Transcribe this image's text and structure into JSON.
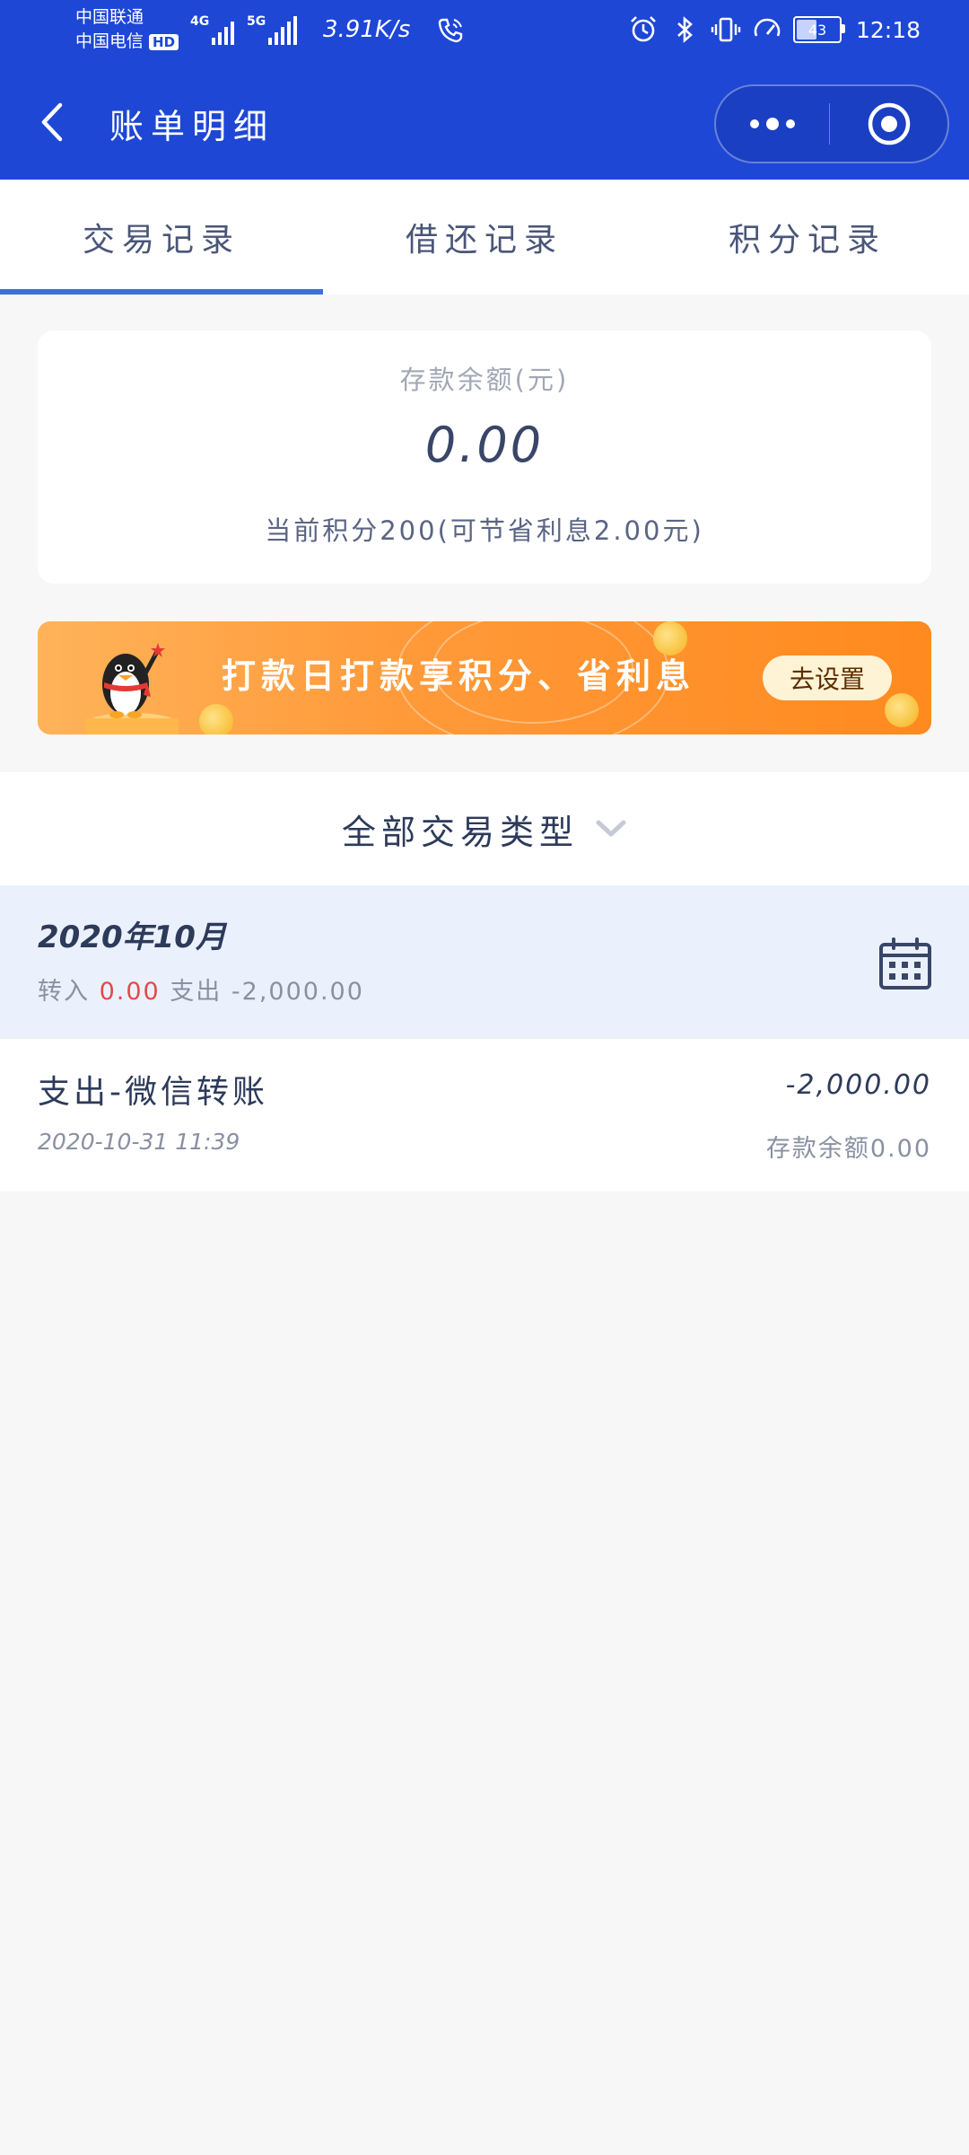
{
  "status_bar": {
    "carrier_1": "中国联通",
    "carrier_2": "中国电信",
    "hd_badge": "HD",
    "signal_1_label": "4G",
    "signal_2_label": "5G",
    "net_speed": "3.91K/s",
    "battery_level": "43",
    "time": "12:18"
  },
  "nav": {
    "title": "账单明细"
  },
  "tabs": [
    {
      "label": "交易记录",
      "active": true
    },
    {
      "label": "借还记录",
      "active": false
    },
    {
      "label": "积分记录",
      "active": false
    }
  ],
  "balance_card": {
    "label": "存款余额(元)",
    "amount": "0.00",
    "points_text": "当前积分200(可节省利息2.00元)"
  },
  "promo": {
    "text": "打款日打款享积分、省利息",
    "button_label": "去设置"
  },
  "filter": {
    "label": "全部交易类型"
  },
  "month": {
    "title": "2020年10月",
    "in_label": "转入",
    "in_amount": "0.00",
    "out_label": "支出",
    "out_amount": "-2,000.00"
  },
  "transactions": [
    {
      "title": "支出-微信转账",
      "amount": "-2,000.00",
      "time": "2020-10-31 11:39",
      "balance": "存款余额0.00"
    }
  ],
  "colors": {
    "brand_blue": "#1e47d6",
    "tab_indicator": "#3a6fdc",
    "promo_orange": "#ff8a1f",
    "income_red": "#e24a4a",
    "month_bg": "#eaf1fd"
  }
}
